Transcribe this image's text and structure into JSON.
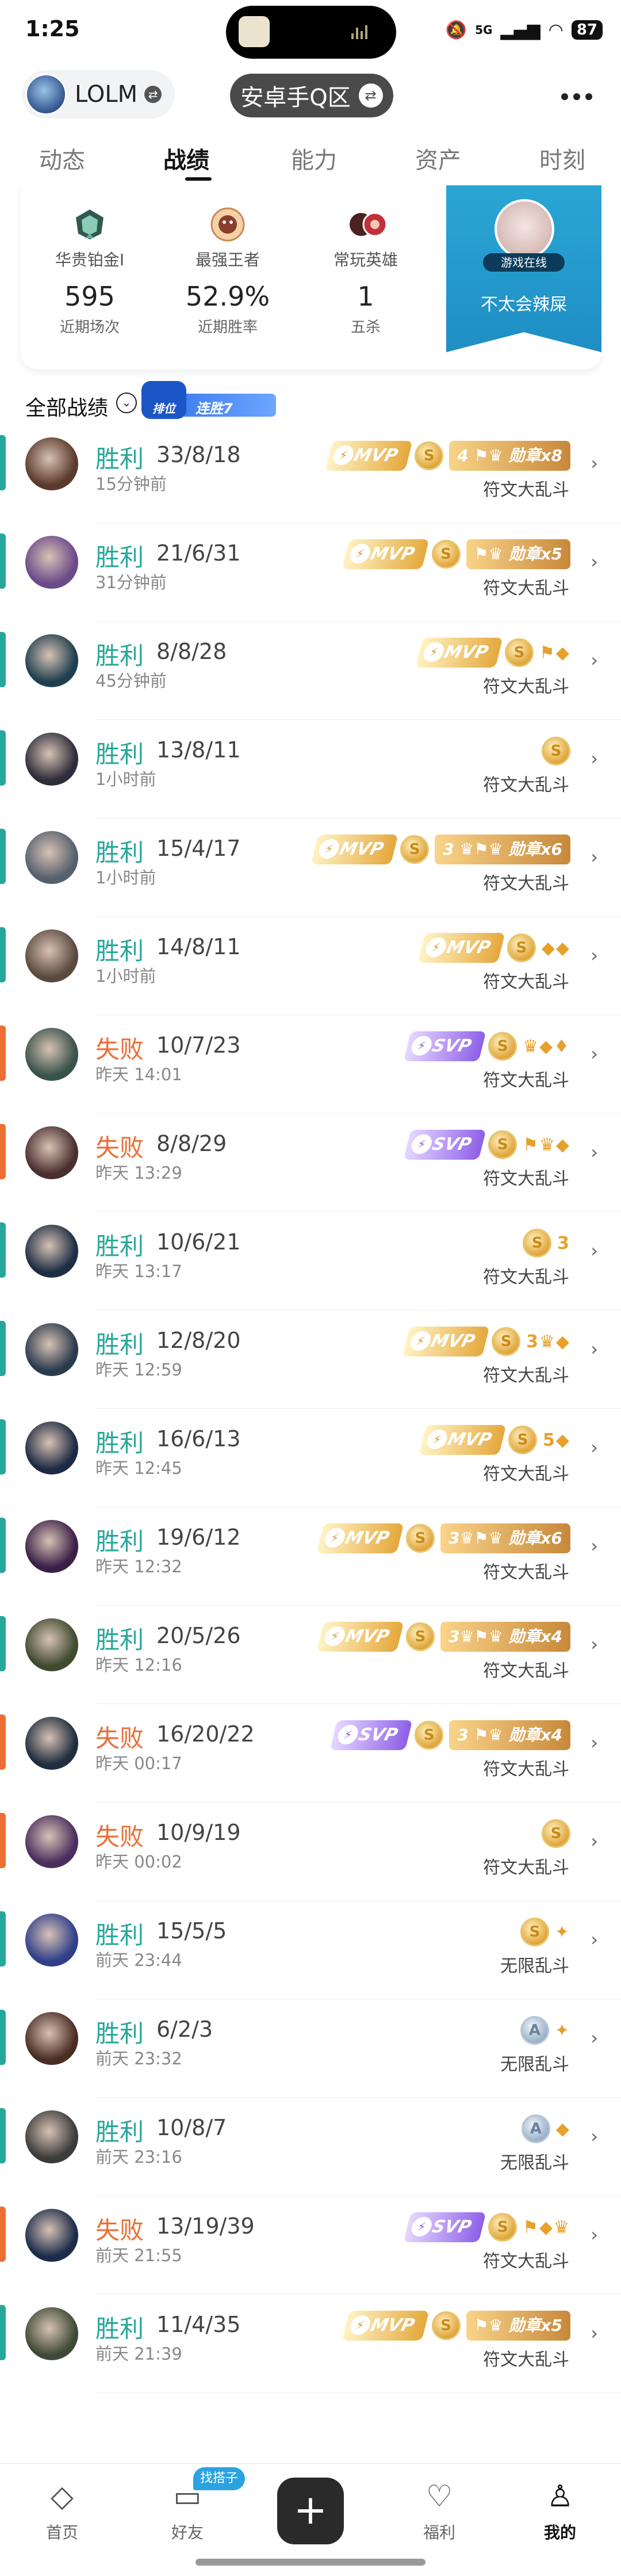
{
  "status": {
    "time": "1:25",
    "battery": "87",
    "network": "5G"
  },
  "header": {
    "account_name": "LOLM",
    "server": "安卓手Q区",
    "more": "•••"
  },
  "tabs": [
    "动态",
    "战绩",
    "能力",
    "资产",
    "时刻"
  ],
  "active_tab": "战绩",
  "stats": [
    {
      "icon": "rank-icon",
      "label": "华贵铂金I",
      "value": "595",
      "sub": "近期场次"
    },
    {
      "icon": "king-icon",
      "label": "最强王者",
      "value": "52.9%",
      "sub": "近期胜率"
    },
    {
      "icon": "heroes-icon",
      "label": "常玩英雄",
      "value": "1",
      "sub": "五杀"
    }
  ],
  "profile_ribbon": {
    "online": "游戏在线",
    "name": "不太会辣屎"
  },
  "section": {
    "title": "全部战绩",
    "rank_badge": "排位",
    "streak": "连胜7"
  },
  "colors": {
    "win": "#27a79a",
    "lose": "#ec6e34",
    "accent": "#2aa3e0"
  },
  "matches": [
    {
      "result": "胜利",
      "kda": "33/8/18",
      "time": "15分钟前",
      "mode": "符文大乱斗",
      "badges": [
        {
          "type": "mvp",
          "text": "MVP"
        },
        {
          "type": "coin",
          "text": "S"
        },
        {
          "type": "medal",
          "text": "4 ⚑♛ 勋章x8"
        }
      ]
    },
    {
      "result": "胜利",
      "kda": "21/6/31",
      "time": "31分钟前",
      "mode": "符文大乱斗",
      "badges": [
        {
          "type": "mvp",
          "text": "MVP"
        },
        {
          "type": "coin",
          "text": "S"
        },
        {
          "type": "medal",
          "text": "⚑♛ 勋章x5"
        }
      ]
    },
    {
      "result": "胜利",
      "kda": "8/8/28",
      "time": "45分钟前",
      "mode": "符文大乱斗",
      "badges": [
        {
          "type": "mvp",
          "text": "MVP"
        },
        {
          "type": "coin",
          "text": "S"
        },
        {
          "type": "sm",
          "text": "⚑◆"
        }
      ]
    },
    {
      "result": "胜利",
      "kda": "13/8/11",
      "time": "1小时前",
      "mode": "符文大乱斗",
      "badges": [
        {
          "type": "coin",
          "text": "S"
        }
      ]
    },
    {
      "result": "胜利",
      "kda": "15/4/17",
      "time": "1小时前",
      "mode": "符文大乱斗",
      "badges": [
        {
          "type": "mvp",
          "text": "MVP"
        },
        {
          "type": "coin",
          "text": "S"
        },
        {
          "type": "medal",
          "text": "3 ♛⚑♛ 勋章x6"
        }
      ]
    },
    {
      "result": "胜利",
      "kda": "14/8/11",
      "time": "1小时前",
      "mode": "符文大乱斗",
      "badges": [
        {
          "type": "mvp",
          "text": "MVP"
        },
        {
          "type": "coin",
          "text": "S"
        },
        {
          "type": "sm",
          "text": "◆◆"
        }
      ]
    },
    {
      "result": "失败",
      "kda": "10/7/23",
      "time": "昨天 14:01",
      "mode": "符文大乱斗",
      "badges": [
        {
          "type": "svp",
          "text": "SVP"
        },
        {
          "type": "coin",
          "text": "S"
        },
        {
          "type": "sm",
          "text": "♛◆♦"
        }
      ]
    },
    {
      "result": "失败",
      "kda": "8/8/29",
      "time": "昨天 13:29",
      "mode": "符文大乱斗",
      "badges": [
        {
          "type": "svp",
          "text": "SVP"
        },
        {
          "type": "coin",
          "text": "S"
        },
        {
          "type": "sm",
          "text": "⚑♛◆"
        }
      ]
    },
    {
      "result": "胜利",
      "kda": "10/6/21",
      "time": "昨天 13:17",
      "mode": "符文大乱斗",
      "badges": [
        {
          "type": "coin",
          "text": "S"
        },
        {
          "type": "sm",
          "text": "3"
        }
      ]
    },
    {
      "result": "胜利",
      "kda": "12/8/20",
      "time": "昨天 12:59",
      "mode": "符文大乱斗",
      "badges": [
        {
          "type": "mvp",
          "text": "MVP"
        },
        {
          "type": "coin",
          "text": "S"
        },
        {
          "type": "sm",
          "text": "3♛◆"
        }
      ]
    },
    {
      "result": "胜利",
      "kda": "16/6/13",
      "time": "昨天 12:45",
      "mode": "符文大乱斗",
      "badges": [
        {
          "type": "mvp",
          "text": "MVP"
        },
        {
          "type": "coin",
          "text": "S"
        },
        {
          "type": "sm",
          "text": "5◆"
        }
      ]
    },
    {
      "result": "胜利",
      "kda": "19/6/12",
      "time": "昨天 12:32",
      "mode": "符文大乱斗",
      "badges": [
        {
          "type": "mvp",
          "text": "MVP"
        },
        {
          "type": "coin",
          "text": "S"
        },
        {
          "type": "medal",
          "text": "3♛⚑♛ 勋章x6"
        }
      ]
    },
    {
      "result": "胜利",
      "kda": "20/5/26",
      "time": "昨天 12:16",
      "mode": "符文大乱斗",
      "badges": [
        {
          "type": "mvp",
          "text": "MVP"
        },
        {
          "type": "coin",
          "text": "S"
        },
        {
          "type": "medal",
          "text": "3♛⚑♛ 勋章x4"
        }
      ]
    },
    {
      "result": "失败",
      "kda": "16/20/22",
      "time": "昨天 00:17",
      "mode": "符文大乱斗",
      "badges": [
        {
          "type": "svp",
          "text": "SVP"
        },
        {
          "type": "coin",
          "text": "S"
        },
        {
          "type": "medal",
          "text": "3 ⚑♛ 勋章x4"
        }
      ]
    },
    {
      "result": "失败",
      "kda": "10/9/19",
      "time": "昨天 00:02",
      "mode": "符文大乱斗",
      "badges": [
        {
          "type": "coin",
          "text": "S"
        }
      ]
    },
    {
      "result": "胜利",
      "kda": "15/5/5",
      "time": "前天 23:44",
      "mode": "无限乱斗",
      "badges": [
        {
          "type": "coin",
          "text": "S"
        },
        {
          "type": "sm",
          "text": "✦"
        }
      ]
    },
    {
      "result": "胜利",
      "kda": "6/2/3",
      "time": "前天 23:32",
      "mode": "无限乱斗",
      "badges": [
        {
          "type": "coinsil",
          "text": "A"
        },
        {
          "type": "sm",
          "text": "✦"
        }
      ]
    },
    {
      "result": "胜利",
      "kda": "10/8/7",
      "time": "前天 23:16",
      "mode": "无限乱斗",
      "badges": [
        {
          "type": "coinsil",
          "text": "A"
        },
        {
          "type": "sm",
          "text": "◆"
        }
      ]
    },
    {
      "result": "失败",
      "kda": "13/19/39",
      "time": "前天 21:55",
      "mode": "符文大乱斗",
      "badges": [
        {
          "type": "svp",
          "text": "SVP"
        },
        {
          "type": "coin",
          "text": "S"
        },
        {
          "type": "sm",
          "text": "⚑◆♛"
        }
      ]
    },
    {
      "result": "胜利",
      "kda": "11/4/35",
      "time": "前天 21:39",
      "mode": "符文大乱斗",
      "badges": [
        {
          "type": "mvp",
          "text": "MVP"
        },
        {
          "type": "coin",
          "text": "S"
        },
        {
          "type": "medal",
          "text": "⚑♛ 勋章x5"
        }
      ]
    }
  ],
  "nav": {
    "friends_tag": "找搭子",
    "items": [
      {
        "label": "首页",
        "icon": "home-icon"
      },
      {
        "label": "好友",
        "icon": "friends-icon"
      },
      {
        "label": "福利",
        "icon": "gift-icon"
      },
      {
        "label": "我的",
        "icon": "profile-icon"
      }
    ]
  }
}
